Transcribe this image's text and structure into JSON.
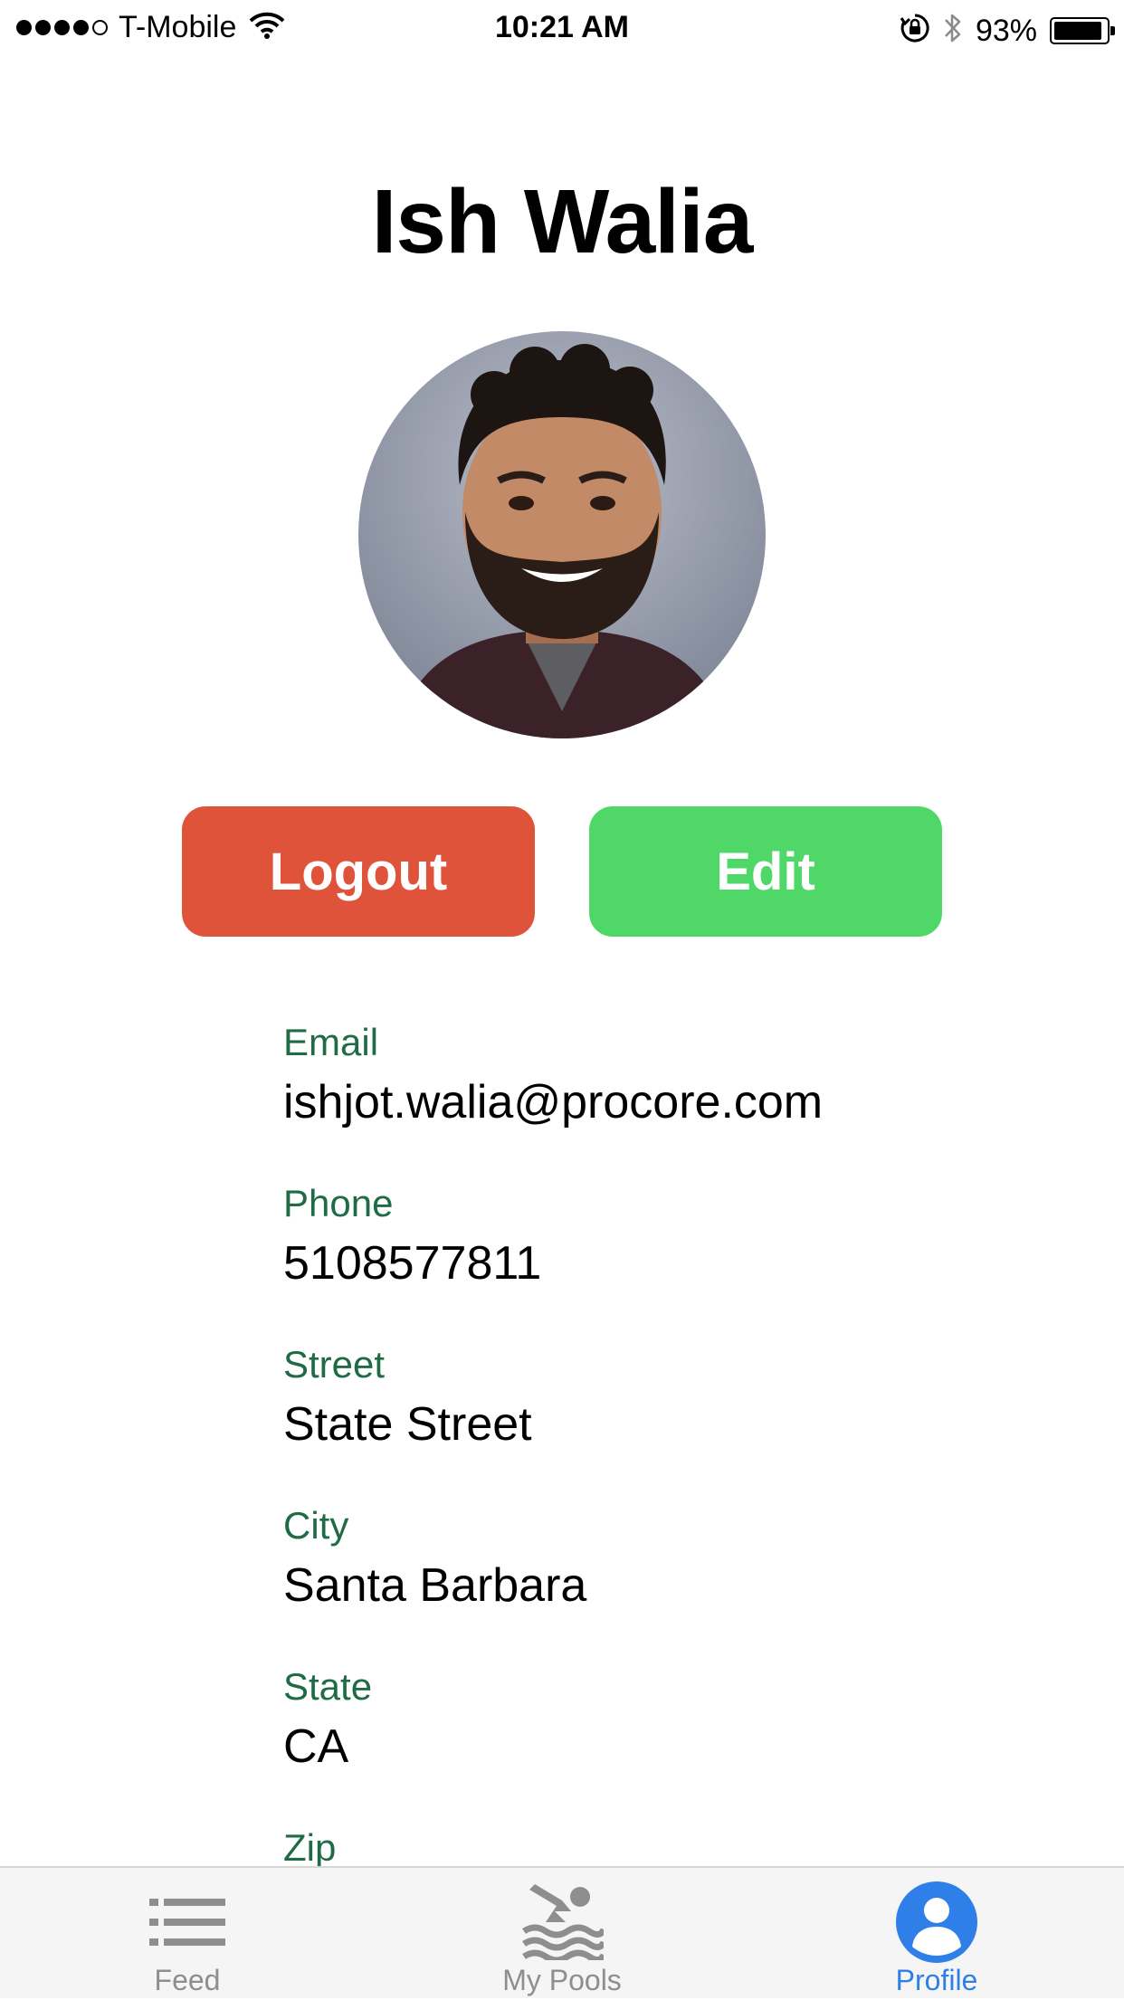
{
  "status_bar": {
    "carrier": "T-Mobile",
    "time": "10:21 AM",
    "battery_percent": "93%",
    "battery_level": 0.93,
    "signal_bars_filled": 4,
    "signal_bars_total": 5,
    "icons": [
      "wifi-icon",
      "orientation-lock-icon",
      "bluetooth-icon",
      "battery-icon"
    ]
  },
  "profile": {
    "name": "Ish Walia",
    "avatar_alt": "avatar"
  },
  "actions": {
    "logout_label": "Logout",
    "edit_label": "Edit",
    "logout_color": "#df533a",
    "edit_color": "#4fd868"
  },
  "fields": {
    "email": {
      "label": "Email",
      "value": "ishjot.walia@procore.com"
    },
    "phone": {
      "label": "Phone",
      "value": "5108577811"
    },
    "street": {
      "label": "Street",
      "value": "State Street"
    },
    "city": {
      "label": "City",
      "value": "Santa Barbara"
    },
    "state": {
      "label": "State",
      "value": "CA"
    },
    "zip": {
      "label": "Zip",
      "value": ""
    }
  },
  "label_color": "#1f6b46",
  "tab_bar": {
    "tabs": [
      {
        "label": "Feed",
        "icon": "list-icon",
        "active": false
      },
      {
        "label": "My Pools",
        "icon": "swimmer-icon",
        "active": false
      },
      {
        "label": "Profile",
        "icon": "user-circle-icon",
        "active": true
      }
    ],
    "active_color": "#2f7fe8",
    "inactive_color": "#8e8e8e"
  }
}
